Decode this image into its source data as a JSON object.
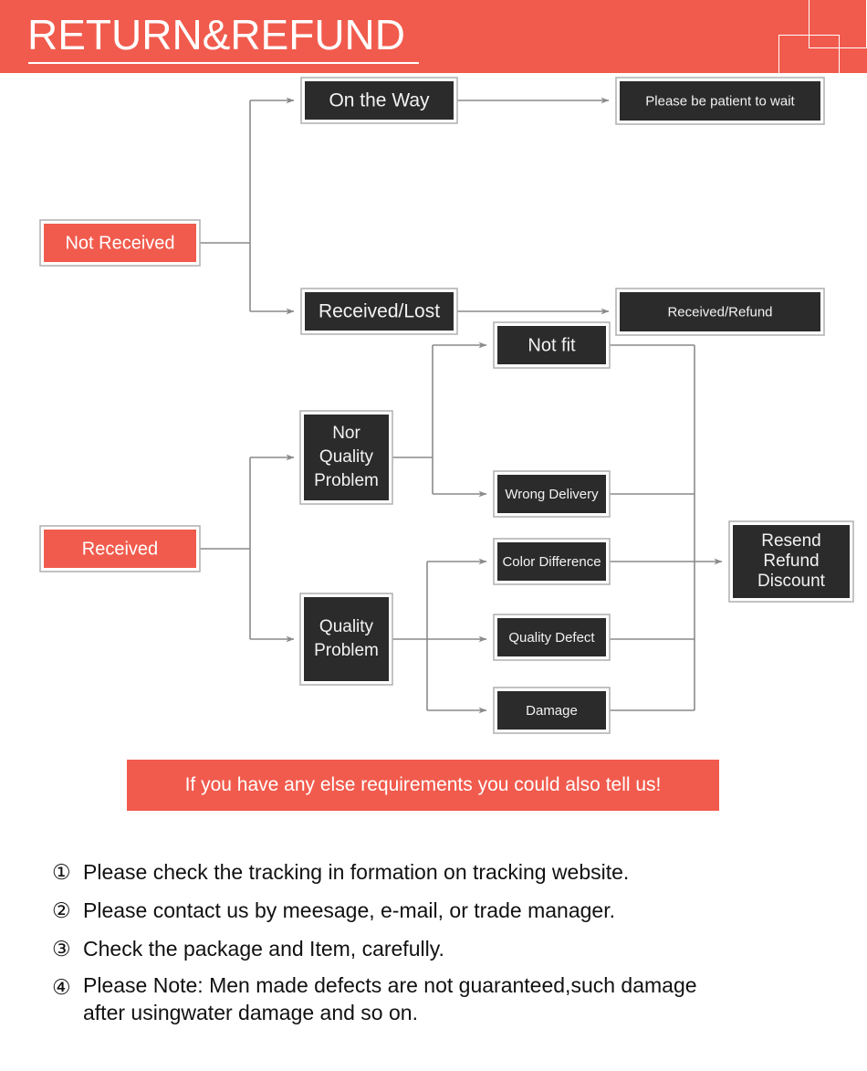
{
  "header": {
    "title": "RETURN&REFUND",
    "banner_color": "#f15b4d",
    "text_color": "#ffffff"
  },
  "flow_not_received": {
    "source": {
      "label": "Not Received",
      "fill": "#f15b4d"
    },
    "branches": [
      {
        "label": "On the Way",
        "fill": "#2b2b2b",
        "result": "Please be patient to wait"
      },
      {
        "label": "Received/Lost",
        "fill": "#2b2b2b",
        "result": "Received/Refund"
      }
    ],
    "results": [
      {
        "label": "Please be patient to wait",
        "fill": "#2b2b2b"
      },
      {
        "label": "Received/Refund",
        "fill": "#2b2b2b"
      }
    ]
  },
  "flow_received": {
    "source": {
      "label": "Received",
      "fill": "#f15b4d"
    },
    "categories": [
      {
        "label": "Nor Quality Problem",
        "lines": [
          "Nor",
          "Quality",
          "Problem"
        ],
        "fill": "#2b2b2b"
      },
      {
        "label": "Quality Problem",
        "lines": [
          "Quality",
          "Problem"
        ],
        "fill": "#2b2b2b"
      }
    ],
    "reasons": [
      {
        "label": "Not fit",
        "fill": "#2b2b2b",
        "category": "Nor Quality Problem"
      },
      {
        "label": "Wrong Delivery",
        "fill": "#2b2b2b",
        "category": "Nor Quality Problem"
      },
      {
        "label": "Color Difference",
        "fill": "#2b2b2b",
        "category": "Quality Problem"
      },
      {
        "label": "Quality Defect",
        "fill": "#2b2b2b",
        "category": "Quality Problem"
      },
      {
        "label": "Damage",
        "fill": "#2b2b2b",
        "category": "Quality Problem"
      }
    ],
    "outcome": {
      "label": "Resend Refund Discount",
      "lines": [
        "Resend",
        "Refund",
        "Discount"
      ],
      "fill": "#2b2b2b"
    }
  },
  "callout": {
    "text": "If you have any else requirements you could also tell us!",
    "background": "#f15b4d",
    "text_color": "#ffffff"
  },
  "notes": [
    {
      "number": "①",
      "text": "Please check the tracking in formation on tracking website."
    },
    {
      "number": "②",
      "text": "Please contact us by meesage, e-mail, or trade manager."
    },
    {
      "number": "③",
      "text": "Check the package and Item, carefully."
    },
    {
      "number": "④",
      "text": "Please Note: Men made defects are not guaranteed,such damage",
      "text2": "after usingwater damage and so on."
    }
  ]
}
